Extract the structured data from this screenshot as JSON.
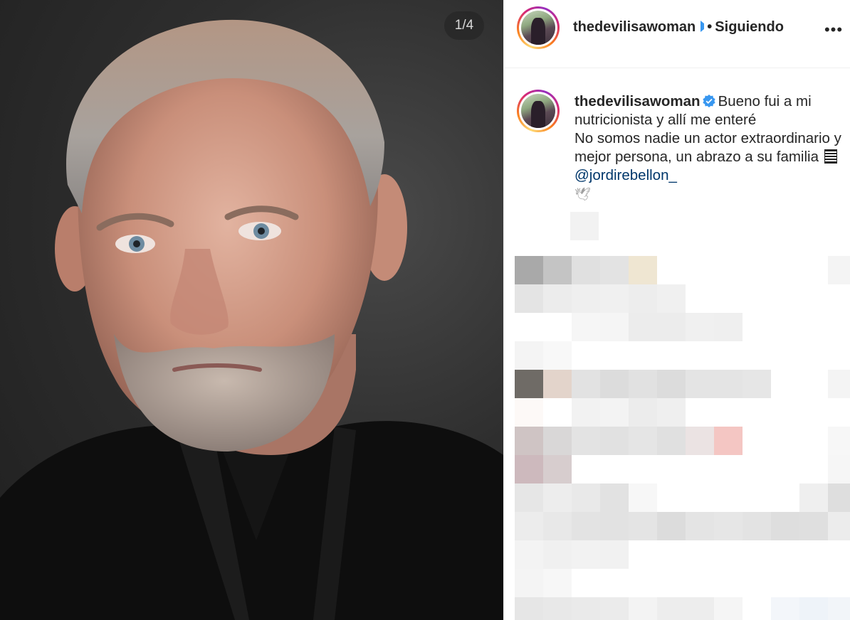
{
  "carousel": {
    "counter": "1/4"
  },
  "header": {
    "username": "thedevilisawoman",
    "separator": "•",
    "follow_state": "Siguiendo",
    "more_label": "•••"
  },
  "caption": {
    "username": "thedevilisawoman",
    "text_before": "Bueno fui a mi nutricionista y allí me enteré",
    "text_line2": "No somos nadie un actor extraordinario y mejor persona, un abrazo a su familia",
    "mention": "@jordirebellon_",
    "dove": "🕊"
  },
  "colors": {
    "accent_link": "#00376b",
    "verified_blue": "#3897f0",
    "text": "#262626"
  },
  "icons": [
    "verified-badge-icon",
    "more-options-icon",
    "dove-emoji-icon"
  ]
}
